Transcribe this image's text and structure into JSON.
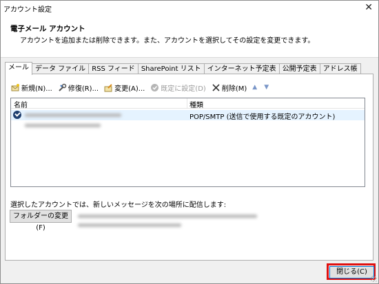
{
  "window": {
    "title": "アカウント設定",
    "close_glyph": "✕"
  },
  "header": {
    "title": "電子メール アカウント",
    "description": "アカウントを追加または削除できます。また、アカウントを選択してその設定を変更できます。"
  },
  "tabs": [
    {
      "label": "メール",
      "active": true
    },
    {
      "label": "データ ファイル"
    },
    {
      "label": "RSS フィード"
    },
    {
      "label": "SharePoint リスト"
    },
    {
      "label": "インターネット予定表"
    },
    {
      "label": "公開予定表"
    },
    {
      "label": "アドレス帳"
    }
  ],
  "toolbar": {
    "new": "新規(N)...",
    "repair": "修復(R)...",
    "change": "変更(A)...",
    "default": "既定に設定(D)",
    "delete": "削除(M)",
    "up_glyph": "▲",
    "down_glyph": "▼"
  },
  "list": {
    "col_name": "名前",
    "col_type": "種類",
    "rows": [
      {
        "type": "POP/SMTP (送信で使用する既定のアカウント)"
      }
    ]
  },
  "deliver_label": "選択したアカウントでは、新しいメッセージを次の場所に配信します:",
  "folder_button": "フォルダーの変更(F)",
  "close_button": "閉じる(C)",
  "colors": {
    "highlight": "#e01010",
    "selection": "#e5f3ff",
    "check": "#1f3f6f"
  }
}
